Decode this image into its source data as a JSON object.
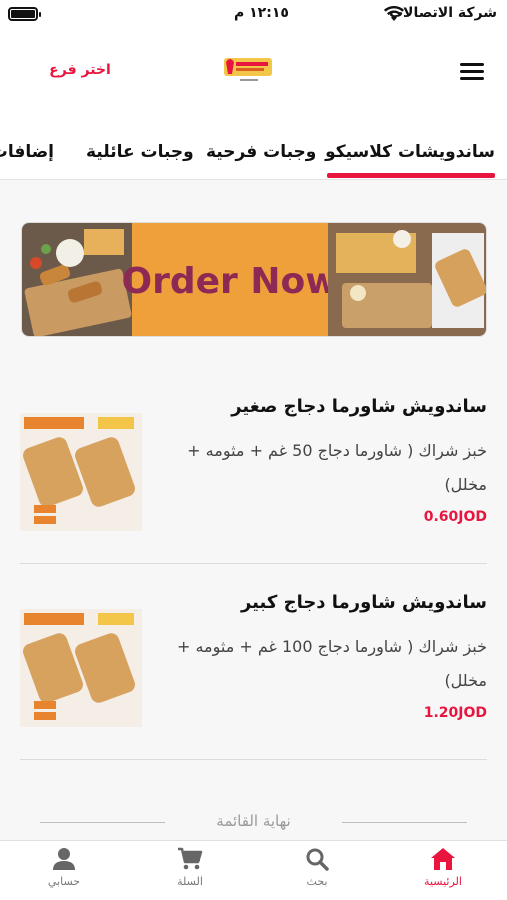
{
  "status": {
    "carrier": "شركة الاتصالات",
    "time": "١٢:١٥ م"
  },
  "header": {
    "branch_label": "اختر فرع"
  },
  "tabs": [
    {
      "label": "ساندويشات كلاسيكو"
    },
    {
      "label": "وجبات فرحية"
    },
    {
      "label": "وجبات عائلية"
    },
    {
      "label": "إضافات"
    }
  ],
  "banner": {
    "text": "Order Now"
  },
  "items": [
    {
      "name": "ساندويش شاورما دجاج صغير",
      "description": "خبز شراك ( شاورما دجاج 50 غم + مثومه + مخلل)",
      "price": "0.60JOD"
    },
    {
      "name": "ساندويش شاورما دجاج كبير",
      "description": "خبز شراك ( شاورما دجاج 100 غم + مثومه + مخلل)",
      "price": "1.20JOD"
    }
  ],
  "list_end": "نهاية القائمة",
  "bottom_nav": [
    {
      "label": "الرئيسية",
      "icon": "home-icon"
    },
    {
      "label": "بحث",
      "icon": "search-icon"
    },
    {
      "label": "السلة",
      "icon": "cart-icon"
    },
    {
      "label": "حسابي",
      "icon": "user-icon"
    }
  ],
  "colors": {
    "accent": "#e8153f",
    "banner_orange": "#f0a03a",
    "banner_text": "#8c2a55"
  }
}
